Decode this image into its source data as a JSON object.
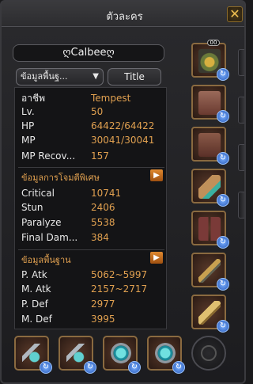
{
  "window": {
    "title": "ตัวละคร",
    "close_label": "✕"
  },
  "character": {
    "name": "ღCalbeeღ"
  },
  "controls": {
    "dropdown_label": "ข้อมูลพื้นฐ...",
    "title_button": "Title"
  },
  "basic_info": [
    {
      "label": "อาชีพ",
      "value": "Tempest"
    },
    {
      "label": "Lv.",
      "value": "50"
    },
    {
      "label": "HP",
      "value": "64422/64422"
    },
    {
      "label": "MP",
      "value": "30041/30041"
    },
    {
      "label": "MP Recov...",
      "value": "157"
    }
  ],
  "special_attack": {
    "header": "ข้อมูลการโจมตีพิเศษ",
    "rows": [
      {
        "label": "Critical",
        "value": "10741"
      },
      {
        "label": "Stun",
        "value": "2406"
      },
      {
        "label": "Paralyze",
        "value": "5538"
      },
      {
        "label": "Final Dam...",
        "value": "384"
      }
    ]
  },
  "basic_stats": {
    "header": "ข้อมูลพื้นฐาน",
    "rows": [
      {
        "label": "P. Atk",
        "value": "5062~5997"
      },
      {
        "label": "M. Atk",
        "value": "2157~2717"
      },
      {
        "label": "P. Def",
        "value": "2977"
      },
      {
        "label": "M. Def",
        "value": "3995"
      }
    ]
  },
  "equipment": {
    "slots": [
      {
        "name": "helmet-slot",
        "icon": "winged-helmet-icon",
        "badge": "00"
      },
      {
        "name": "armor-slot",
        "icon": "armor-icon"
      },
      {
        "name": "gloves-slot",
        "icon": "gauntlet-icon"
      },
      {
        "name": "bracer-slot",
        "icon": "bracer-icon"
      },
      {
        "name": "pants-slot",
        "icon": "leggings-icon"
      },
      {
        "name": "weapon-main-slot",
        "icon": "dagger-icon"
      },
      {
        "name": "weapon-off-slot",
        "icon": "blade-icon"
      }
    ],
    "accessories": [
      {
        "name": "earring-left-slot",
        "icon": "earring-icon"
      },
      {
        "name": "earring-right-slot",
        "icon": "earring-icon"
      },
      {
        "name": "ring-left-slot",
        "icon": "ring-icon"
      },
      {
        "name": "ring-right-slot",
        "icon": "ring-icon"
      }
    ]
  },
  "colors": {
    "value_text": "#e0a050",
    "section_header": "#e0a050",
    "label_text": "#e8e8e8"
  }
}
